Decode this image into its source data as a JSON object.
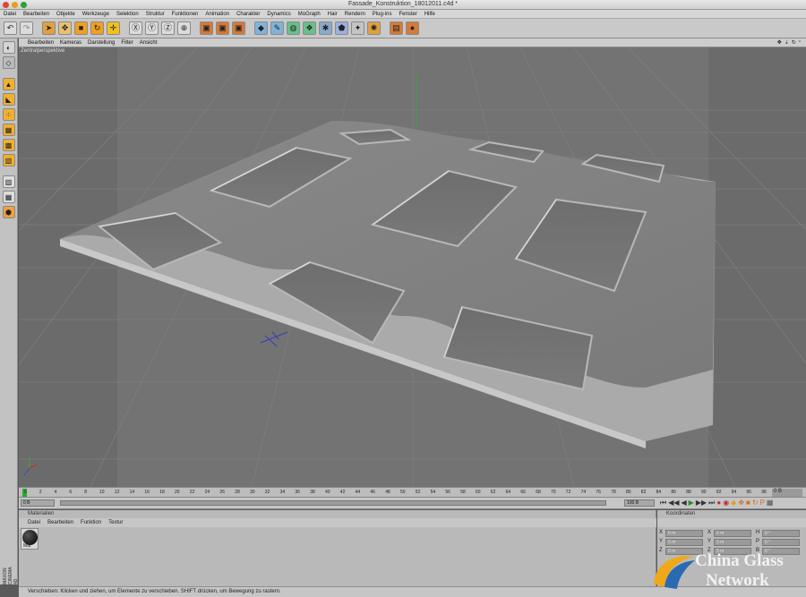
{
  "window": {
    "title": "Fassade_Konstruktion_18012011.c4d *"
  },
  "menubar": {
    "items": [
      "Datei",
      "Bearbeiten",
      "Objekte",
      "Werkzeuge",
      "Selektion",
      "Struktur",
      "Funktionen",
      "Animation",
      "Charakter",
      "Dynamics",
      "MoGraph",
      "Hair",
      "Rendern",
      "Plug-ins",
      "Fenster",
      "Hilfe"
    ]
  },
  "viewport": {
    "menu": [
      "Bearbeiten",
      "Kameras",
      "Darstellung",
      "Filter",
      "Ansicht"
    ],
    "camera_label": "Zentralperspektive"
  },
  "timeline": {
    "ticks": [
      "0",
      "2",
      "4",
      "6",
      "8",
      "10",
      "12",
      "14",
      "16",
      "18",
      "20",
      "22",
      "24",
      "26",
      "28",
      "30",
      "32",
      "34",
      "36",
      "38",
      "40",
      "42",
      "44",
      "46",
      "48",
      "50",
      "52",
      "54",
      "56",
      "58",
      "60",
      "62",
      "64",
      "66",
      "68",
      "70",
      "72",
      "74",
      "76",
      "78",
      "80",
      "82",
      "84",
      "86",
      "88",
      "90",
      "92",
      "94",
      "96",
      "98",
      "10"
    ],
    "frame_readout": "0 B",
    "start_field": "0 B",
    "end_field": "100 B"
  },
  "materials": {
    "panel_title": "Materialien",
    "menu": [
      "Datei",
      "Bearbeiten",
      "Funktion",
      "Textur"
    ],
    "swatch_label": "Mat"
  },
  "coordinates": {
    "panel_title": "Koordinaten",
    "rows": [
      {
        "a": "X",
        "av": "0 m",
        "b": "X",
        "bv": "0 m",
        "c": "H",
        "cv": "0 °"
      },
      {
        "a": "Y",
        "av": "0 m",
        "b": "Y",
        "bv": "0 m",
        "c": "P",
        "cv": "0 °"
      },
      {
        "a": "Z",
        "av": "0 m",
        "b": "Z",
        "bv": "0 m",
        "c": "B",
        "cv": "0 °"
      }
    ]
  },
  "status": {
    "text": "Verschieben: Klicken und ziehen, um Elemente zu verschieben. SHIFT drücken, um Bewegung zu rastern."
  },
  "brand": {
    "side_logo": "MAXON CINEMA 4D"
  },
  "watermark": {
    "line1": "China Glass",
    "line2": "Network"
  },
  "colors": {
    "ui_bg": "#c6c6c6",
    "viewport_bg": "#6c6c6c",
    "grid": "#7d7d7d",
    "timeline_marker": "#2eaa2e"
  }
}
